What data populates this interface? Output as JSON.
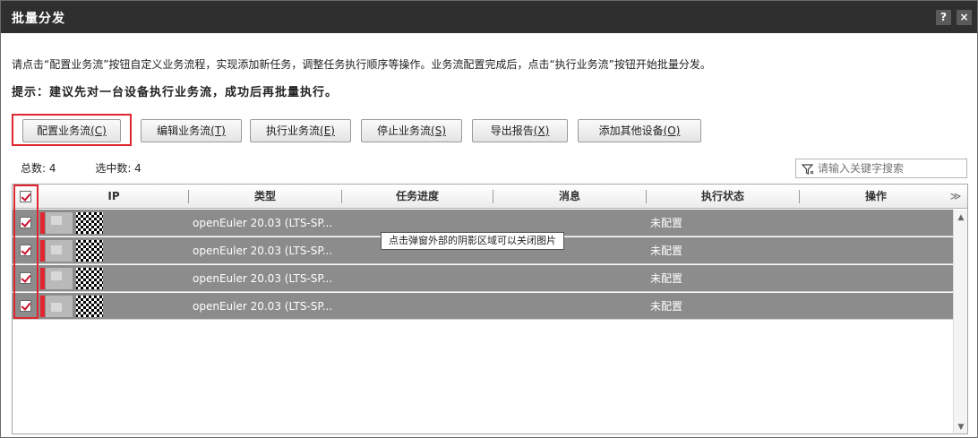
{
  "window": {
    "title": "批量分发",
    "help_label": "?",
    "close_label": "×"
  },
  "description": "请点击“配置业务流”按钮自定义业务流程，实现添加新任务，调整任务执行顺序等操作。业务流配置完成后，点击“执行业务流”按钮开始批量分发。",
  "hint": "提示：建议先对一台设备执行业务流，成功后再批量执行。",
  "toolbar": {
    "configure": {
      "label": "配置业务流",
      "key": "(C)"
    },
    "edit": {
      "label": "编辑业务流",
      "key": "(T)"
    },
    "execute": {
      "label": "执行业务流",
      "key": "(E)"
    },
    "stop": {
      "label": "停止业务流",
      "key": "(S)"
    },
    "export": {
      "label": "导出报告",
      "key": "(X)"
    },
    "add_device": {
      "label": "添加其他设备",
      "key": "(O)"
    }
  },
  "counts": {
    "total": "总数: 4",
    "selected": "选中数: 4"
  },
  "search": {
    "placeholder": "请输入关键字搜索"
  },
  "table": {
    "columns": [
      "IP",
      "类型",
      "任务进度",
      "消息",
      "执行状态",
      "操作"
    ],
    "rows": [
      {
        "ip": "",
        "type": "openEuler 20.03 (LTS-SP...",
        "progress": "",
        "message": "",
        "status": "未配置",
        "action": ""
      },
      {
        "ip": "",
        "type": "openEuler 20.03 (LTS-SP...",
        "progress": "",
        "message": "",
        "status": "未配置",
        "action": ""
      },
      {
        "ip": "",
        "type": "openEuler 20.03 (LTS-SP...",
        "progress": "",
        "message": "",
        "status": "未配置",
        "action": ""
      },
      {
        "ip": "",
        "type": "openEuler 20.03 (LTS-SP...",
        "progress": "",
        "message": "",
        "status": "未配置",
        "action": ""
      }
    ]
  },
  "tooltip": "点击弹窗外部的阴影区域可以关闭图片",
  "colors": {
    "titlebar": "#2f2f2f",
    "row_selected": "#8c8c8c",
    "highlight": "#e0262e",
    "check": "#c8102e"
  }
}
